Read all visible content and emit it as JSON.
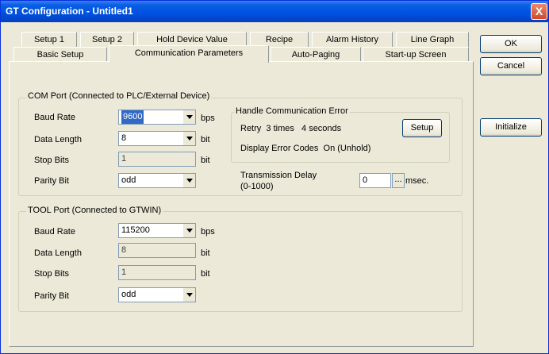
{
  "window": {
    "title": "GT Configuration - Untitled1",
    "close_glyph": "X"
  },
  "tabs_row1": [
    "Setup 1",
    "Setup 2",
    "Hold Device Value",
    "Recipe",
    "Alarm History",
    "Line Graph"
  ],
  "tabs_row2": [
    "Basic Setup",
    "Communication Parameters",
    "Auto-Paging",
    "Start-up Screen"
  ],
  "selected_tab": "Communication Parameters",
  "buttons": {
    "ok": "OK",
    "cancel": "Cancel",
    "initialize": "Initialize",
    "setup": "Setup",
    "dots": "..."
  },
  "com_port": {
    "title": "COM Port (Connected to PLC/External Device)",
    "baud_rate_label": "Baud Rate",
    "baud_rate": "9600",
    "baud_unit": "bps",
    "data_length_label": "Data Length",
    "data_length": "8",
    "data_unit": "bit",
    "stop_bits_label": "Stop Bits",
    "stop_bits": "1",
    "stop_unit": "bit",
    "parity_label": "Parity Bit",
    "parity": "odd"
  },
  "handle_error": {
    "title": "Handle Communication Error",
    "retry": "Retry  3 times   4 seconds",
    "display": "Display Error Codes  On (Unhold)"
  },
  "transmission": {
    "label_line1": "Transmission Delay",
    "label_line2": "(0-1000)",
    "value": "0",
    "unit": "msec."
  },
  "tool_port": {
    "title": "TOOL Port (Connected to GTWIN)",
    "baud_rate_label": "Baud Rate",
    "baud_rate": "115200",
    "baud_unit": "bps",
    "data_length_label": "Data Length",
    "data_length": "8",
    "data_unit": "bit",
    "stop_bits_label": "Stop Bits",
    "stop_bits": "1",
    "stop_unit": "bit",
    "parity_label": "Parity Bit",
    "parity": "odd"
  }
}
